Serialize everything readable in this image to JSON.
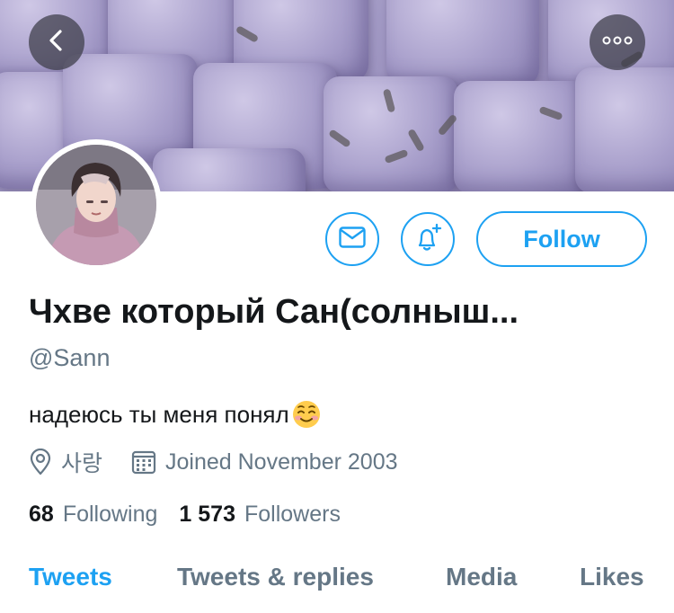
{
  "header": {
    "back_icon": "chevron-left-icon",
    "more_icon": "more-horizontal-icon"
  },
  "profile": {
    "display_name": "Чхве который Сан(солныш...",
    "handle": "@Sann",
    "bio": "надеюсь ты меня понял",
    "bio_emoji": "smiling-face-icon",
    "location": "사랑",
    "joined": "Joined November 2003"
  },
  "actions": {
    "message_icon": "envelope-icon",
    "notify_icon": "bell-plus-icon",
    "follow_label": "Follow"
  },
  "stats": {
    "following_count": "68",
    "following_label": "Following",
    "followers_count": "1 573",
    "followers_label": "Followers"
  },
  "tabs": [
    {
      "label": "Tweets",
      "active": true
    },
    {
      "label": "Tweets & replies",
      "active": false
    },
    {
      "label": "Media",
      "active": false
    },
    {
      "label": "Likes",
      "active": false
    }
  ],
  "colors": {
    "accent": "#1da1f2",
    "secondary_text": "#657786",
    "primary_text": "#14171a"
  }
}
